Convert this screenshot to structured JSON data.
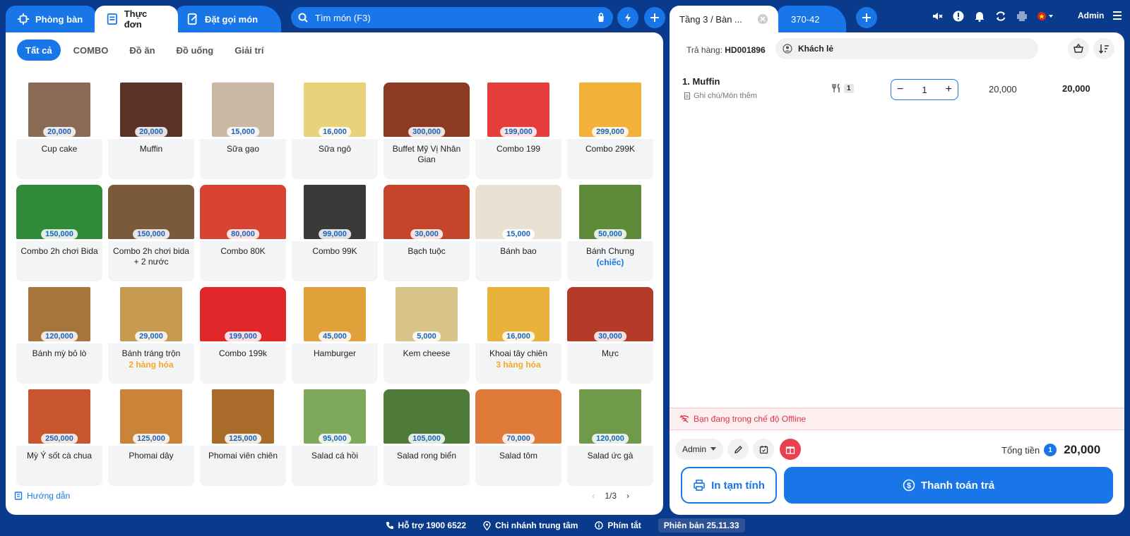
{
  "tabs": {
    "phong_ban": "Phòng bàn",
    "thuc_don": "Thực đơn",
    "dat_goi_mon": "Đặt gọi món"
  },
  "search": {
    "placeholder": "Tìm món (F3)"
  },
  "categories": [
    "Tất cả",
    "COMBO",
    "Đồ ăn",
    "Đồ uống",
    "Giải trí"
  ],
  "products": [
    {
      "name": "Cup cake",
      "price": "20,000",
      "color": "#8a6a55"
    },
    {
      "name": "Muffin",
      "price": "20,000",
      "color": "#5a3327"
    },
    {
      "name": "Sữa gạo",
      "price": "15,000",
      "color": "#c9b9a4"
    },
    {
      "name": "Sữa ngô",
      "price": "16,000",
      "color": "#e8d27a"
    },
    {
      "name": "Buffet Mỹ Vị Nhân Gian",
      "price": "300,000",
      "color": "#8c3a22",
      "wide": true
    },
    {
      "name": "Combo 199",
      "price": "199,000",
      "color": "#e63c3c"
    },
    {
      "name": "Combo 299K",
      "price": "299,000",
      "color": "#f3b13a"
    },
    {
      "name": "Combo 2h chơi Bida",
      "price": "150,000",
      "color": "#2f8a3a",
      "wide": true
    },
    {
      "name": "Combo 2h chơi bida + 2 nước",
      "price": "150,000",
      "color": "#7a5a3a",
      "wide": true
    },
    {
      "name": "Combo 80K",
      "price": "80,000",
      "color": "#d94334",
      "wide": true
    },
    {
      "name": "Combo 99K",
      "price": "99,000",
      "color": "#3a3a3a"
    },
    {
      "name": "Bạch tuộc",
      "price": "30,000",
      "color": "#c4452a",
      "wide": true
    },
    {
      "name": "Bánh bao",
      "price": "15,000",
      "color": "#e8e1d4",
      "wide": true
    },
    {
      "name": "Bánh Chưng",
      "price": "50,000",
      "color": "#5e8a3a",
      "sub": "(chiếc)",
      "subColor": "blue"
    },
    {
      "name": "Bánh mỳ bỏ lò",
      "price": "120,000",
      "color": "#a8743d"
    },
    {
      "name": "Bánh tráng trộn",
      "price": "29,000",
      "color": "#c79a52",
      "sub": "2 hàng hóa",
      "subColor": "orange"
    },
    {
      "name": "Combo 199k",
      "price": "199,000",
      "color": "#e0272a",
      "wide": true
    },
    {
      "name": "Hamburger",
      "price": "45,000",
      "color": "#e0a03a"
    },
    {
      "name": "Kem cheese",
      "price": "5,000",
      "color": "#d8c388"
    },
    {
      "name": "Khoai tây chiên",
      "price": "16,000",
      "color": "#e9b23a",
      "sub": "3 hàng hóa",
      "subColor": "orange"
    },
    {
      "name": "Mực",
      "price": "30,000",
      "color": "#b43a2a",
      "wide": true
    },
    {
      "name": "Mỳ Ý sốt cà chua",
      "price": "250,000",
      "color": "#c9552e"
    },
    {
      "name": "Phomai dây",
      "price": "125,000",
      "color": "#c9843a"
    },
    {
      "name": "Phomai viên chiên",
      "price": "125,000",
      "color": "#a86b2a"
    },
    {
      "name": "Salad cá hồi",
      "price": "95,000",
      "color": "#7ea85a"
    },
    {
      "name": "Salad rong biển",
      "price": "105,000",
      "color": "#4e7a3a",
      "wide": true
    },
    {
      "name": "Salad tôm",
      "price": "70,000",
      "color": "#e07a3a",
      "wide": true
    },
    {
      "name": "Salad ức gà",
      "price": "120,000",
      "color": "#6f9a4a"
    }
  ],
  "guide": "Hướng dẫn",
  "pager": "1/3",
  "right": {
    "tab_active": "Tầng 3 / Bàn ...",
    "tab_other": "370-42",
    "admin": "Admin",
    "order_label": "Trả hàng:",
    "order_code": "HD001896",
    "customer": "Khách lẻ",
    "item_name": "1. Muffin",
    "item_note": "Ghi chú/Món thêm",
    "item_serve_count": "1",
    "item_qty": "1",
    "item_unit_price": "20,000",
    "item_total": "20,000",
    "offline": "Bạn đang trong chế độ Offline",
    "staff": "Admin",
    "total_label": "Tổng tiền",
    "total_count": "1",
    "total_value": "20,000",
    "print_btn": "In tạm tính",
    "pay_btn": "Thanh toán trả"
  },
  "footer": {
    "support": "Hỗ trợ 1900 6522",
    "branch": "Chi nhánh trung tâm",
    "shortcut": "Phím tắt",
    "version": "Phiên bản 25.11.33"
  }
}
